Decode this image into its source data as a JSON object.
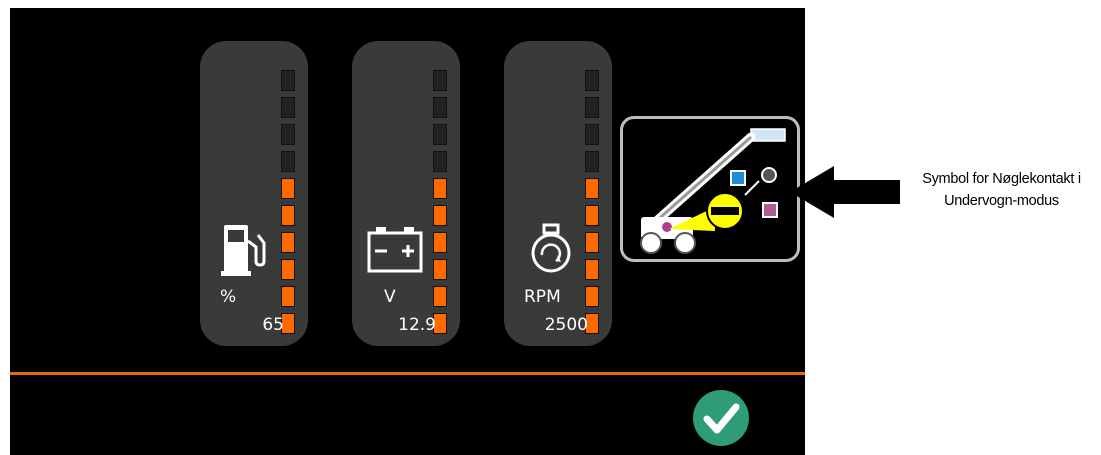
{
  "gauges": [
    {
      "id": "fuel",
      "icon": "fuel-pump-icon",
      "unit": "%",
      "value": "65",
      "segments_total": 10,
      "segments_lit": 6
    },
    {
      "id": "battery",
      "icon": "battery-icon",
      "unit": "V",
      "value": "12.9",
      "segments_total": 10,
      "segments_lit": 6
    },
    {
      "id": "engine",
      "icon": "engine-icon",
      "unit": "RPM",
      "value": "2500",
      "segments_total": 10,
      "segments_lit": 6
    }
  ],
  "mode_symbol": {
    "icon": "boom-lift-key-switch-undercarriage-mode-icon"
  },
  "confirm": {
    "icon": "checkmark-icon"
  },
  "callout": {
    "line1": "Symbol for Nøglekontakt i",
    "line2": "Undervogn-modus"
  },
  "colors": {
    "screen_bg": "#000000",
    "gauge_bg": "#3a3a3a",
    "segment_lit": "#ff6a00",
    "segment_unlit": "#222222",
    "divider": "#e8651a",
    "confirm_bg": "#2e9c78",
    "mode_border": "#bdbdbd"
  }
}
